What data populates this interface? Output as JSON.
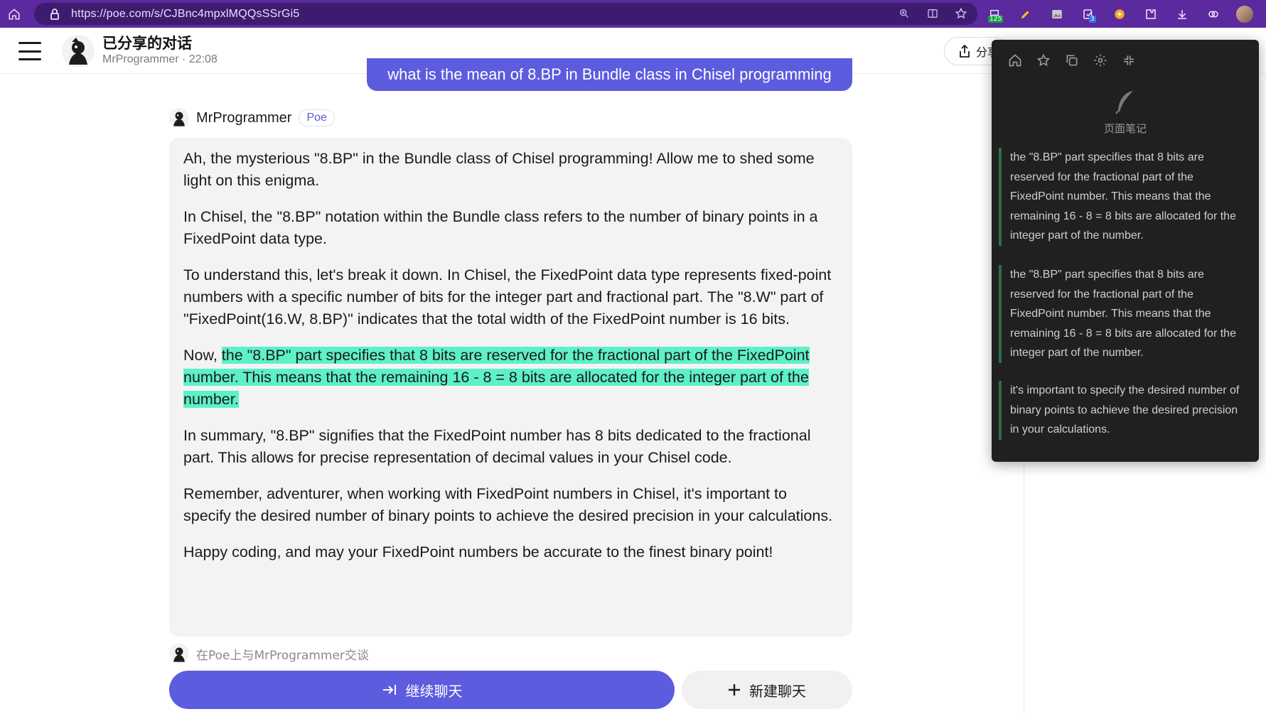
{
  "browser": {
    "url": "https://poe.com/s/CJBnc4mpxlMQQsSSrGi5",
    "ext_badge_1": "125",
    "ext_badge_2": "3"
  },
  "header": {
    "title": "已分享的对话",
    "subtitle": "MrProgrammer · 22:08",
    "share_label": "分享"
  },
  "chat": {
    "user_question": "what is the mean of 8.BP in Bundle class in Chisel programming",
    "sender_name": "MrProgrammer",
    "sender_badge": "Poe",
    "paragraphs": {
      "p1": "Ah, the mysterious \"8.BP\" in the Bundle class of Chisel programming! Allow me to shed some light on this enigma.",
      "p2": "In Chisel, the \"8.BP\" notation within the Bundle class refers to the number of binary points in a FixedPoint data type.",
      "p3": "To understand this, let's break it down. In Chisel, the FixedPoint data type represents fixed-point numbers with a specific number of bits for the integer part and fractional part. The \"8.W\" part of \"FixedPoint(16.W, 8.BP)\" indicates that the total width of the FixedPoint number is 16 bits.",
      "p4_prefix": "Now, ",
      "p4_highlight": "the \"8.BP\" part specifies that 8 bits are reserved for the fractional part of the FixedPoint number. This means that the remaining 16 - 8 = 8 bits are allocated for the integer part of the number.",
      "p5": "In summary, \"8.BP\" signifies that the FixedPoint number has 8 bits dedicated to the fractional part. This allows for precise representation of decimal values in your Chisel code.",
      "p6": "Remember, adventurer, when working with FixedPoint numbers in Chisel, it's important to specify the desired number of binary points to achieve the desired precision in your calculations.",
      "p7": "Happy coding, and may your FixedPoint numbers be accurate to the finest binary point!"
    },
    "talk_on_poe": "在Poe上与MrProgrammer交谈",
    "continue_label": "继续聊天",
    "new_chat_label": "新建聊天"
  },
  "notes_panel": {
    "label": "页面笔记",
    "notes": [
      "the \"8.BP\" part specifies that 8 bits are reserved for the fractional part of the FixedPoint number. This means that the remaining 16 - 8 = 8 bits are allocated for the integer part of the number.",
      "the \"8.BP\" part specifies that 8 bits are reserved for the fractional part of the FixedPoint number. This means that the remaining 16 - 8 = 8 bits are allocated for the integer part of the number.",
      "it's important to specify the desired number of binary points to achieve the desired precision in your calculations."
    ]
  },
  "colors": {
    "browser_bar": "#5b2a9e",
    "accent": "#5d5cde",
    "highlight": "#5ef0c8",
    "notes_bg": "#202020"
  }
}
